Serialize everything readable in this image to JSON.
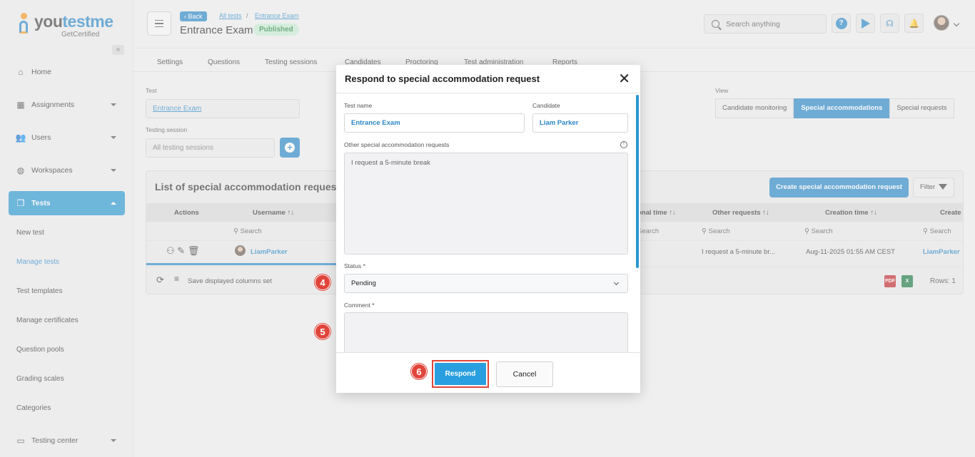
{
  "brand": {
    "name_part1": "you",
    "name_part2": "testme",
    "tagline": "GetCertified"
  },
  "sidebar": {
    "collapse_label": "«",
    "items": [
      {
        "label": "Home",
        "icon": "home-icon"
      },
      {
        "label": "Assignments",
        "icon": "assignments-icon"
      },
      {
        "label": "Users",
        "icon": "users-icon"
      },
      {
        "label": "Workspaces",
        "icon": "globe-icon"
      },
      {
        "label": "Tests",
        "icon": "tests-icon"
      },
      {
        "label": "Testing center",
        "icon": "monitor-icon"
      }
    ],
    "sub_items": [
      "New test",
      "Manage tests",
      "Test templates",
      "Manage certificates",
      "Question pools",
      "Grading scales",
      "Categories"
    ]
  },
  "header": {
    "back_label": "Back",
    "crumbs": [
      "All tests",
      "Entrance Exam"
    ],
    "crumb_sep": "/",
    "title": "Entrance Exam",
    "status_badge": "Published",
    "search_placeholder": "Search anything",
    "help_label": "?"
  },
  "tabs": [
    "Settings",
    "Questions",
    "Testing sessions",
    "Candidates",
    "Proctoring",
    "Test administration",
    "Reports"
  ],
  "filters": {
    "test_label": "Test",
    "test_value": "Entrance Exam",
    "session_label": "Testing session",
    "session_placeholder": "All testing sessions",
    "add_label": "+",
    "view_label": "View",
    "view_options": [
      "Candidate monitoring",
      "Special accommodations",
      "Special requests"
    ]
  },
  "grid": {
    "title": "List of special accommodation requests",
    "create_label": "Create special accommodation request",
    "filter_label": "Filter",
    "columns": {
      "actions": "Actions",
      "username": "Username ↑↓",
      "additional_time": "onal time ↑↓",
      "other_requests": "Other requests ↑↓",
      "creation_time": "Creation time ↑↓",
      "created_by": "Create"
    },
    "search_label": "Search",
    "row": {
      "username": "LiamParker",
      "other_requests": "I request a 5-minute br...",
      "creation_time": "Aug-11-2025 01:55 AM CEST",
      "created_by": "LiamParker"
    },
    "footer": {
      "save_columns": "Save displayed columns set",
      "rows": "Rows: 1",
      "pdf": "PDF",
      "xls": "X"
    }
  },
  "modal": {
    "title": "Respond to special accommodation request",
    "close": "✕",
    "test_name_label": "Test name",
    "test_name_value": "Entrance Exam",
    "candidate_label": "Candidate",
    "candidate_value": "Liam Parker",
    "other_label": "Other special accommodation requests",
    "other_value": "I request a 5-minute break",
    "info": "!",
    "status_label": "Status *",
    "status_value": "Pending",
    "comment_label": "Comment *",
    "respond_label": "Respond",
    "cancel_label": "Cancel"
  },
  "steps": [
    "4",
    "5",
    "6"
  ],
  "colors": {
    "primary": "#2a87c7",
    "step": "#e0453b",
    "published": "#c8ecd3"
  }
}
